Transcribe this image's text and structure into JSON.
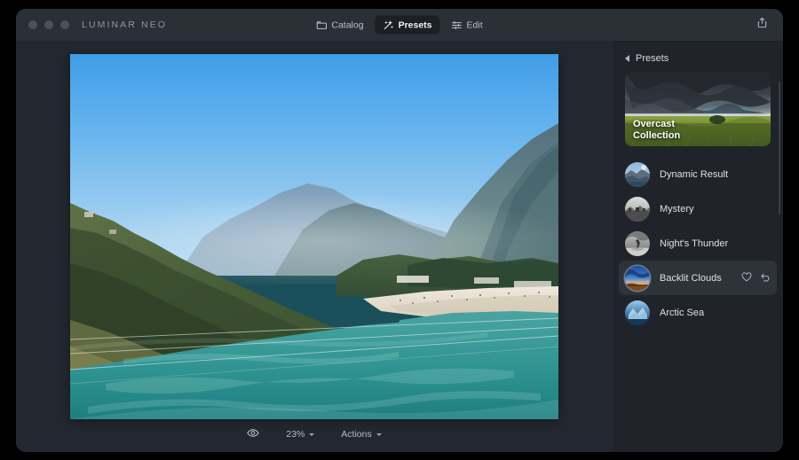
{
  "window": {
    "app_title": "LUMINAR NEO",
    "traffic_lights": [
      "close-button",
      "minimize-button",
      "zoom-button"
    ]
  },
  "toolbar": {
    "tabs": [
      {
        "label": "Catalog",
        "icon": "folder-icon",
        "active": false
      },
      {
        "label": "Presets",
        "icon": "sparkle-wand-icon",
        "active": true
      },
      {
        "label": "Edit",
        "icon": "sliders-icon",
        "active": false
      }
    ],
    "share_icon": "share-export-icon"
  },
  "canvas": {
    "photo_alt": "Turquoise river winding between forested mountains under blue sky"
  },
  "bottombar": {
    "preview_icon": "eye-icon",
    "zoom_level": "23%",
    "actions_label": "Actions"
  },
  "sidebar": {
    "back_icon": "chevron-left-icon",
    "header_title": "Presets",
    "collection": {
      "title_line1": "Overcast",
      "title_line2": "Collection"
    },
    "presets": [
      {
        "name": "Dynamic Result",
        "selected": false
      },
      {
        "name": "Mystery",
        "selected": false
      },
      {
        "name": "Night's Thunder",
        "selected": false
      },
      {
        "name": "Backlit Clouds",
        "selected": true
      },
      {
        "name": "Arctic Sea",
        "selected": false
      }
    ],
    "row_actions": {
      "favorite_icon": "heart-icon",
      "reset_icon": "undo-arrow-icon"
    }
  },
  "colors": {
    "window_bg": "#2b2f36",
    "sidebar_bg": "#20242a",
    "stage_bg": "#232830",
    "selected_row": "#2e3339",
    "active_tab_bg": "#1c1f25",
    "text_primary": "#dbe0e7",
    "text_muted": "#8e97a6"
  }
}
